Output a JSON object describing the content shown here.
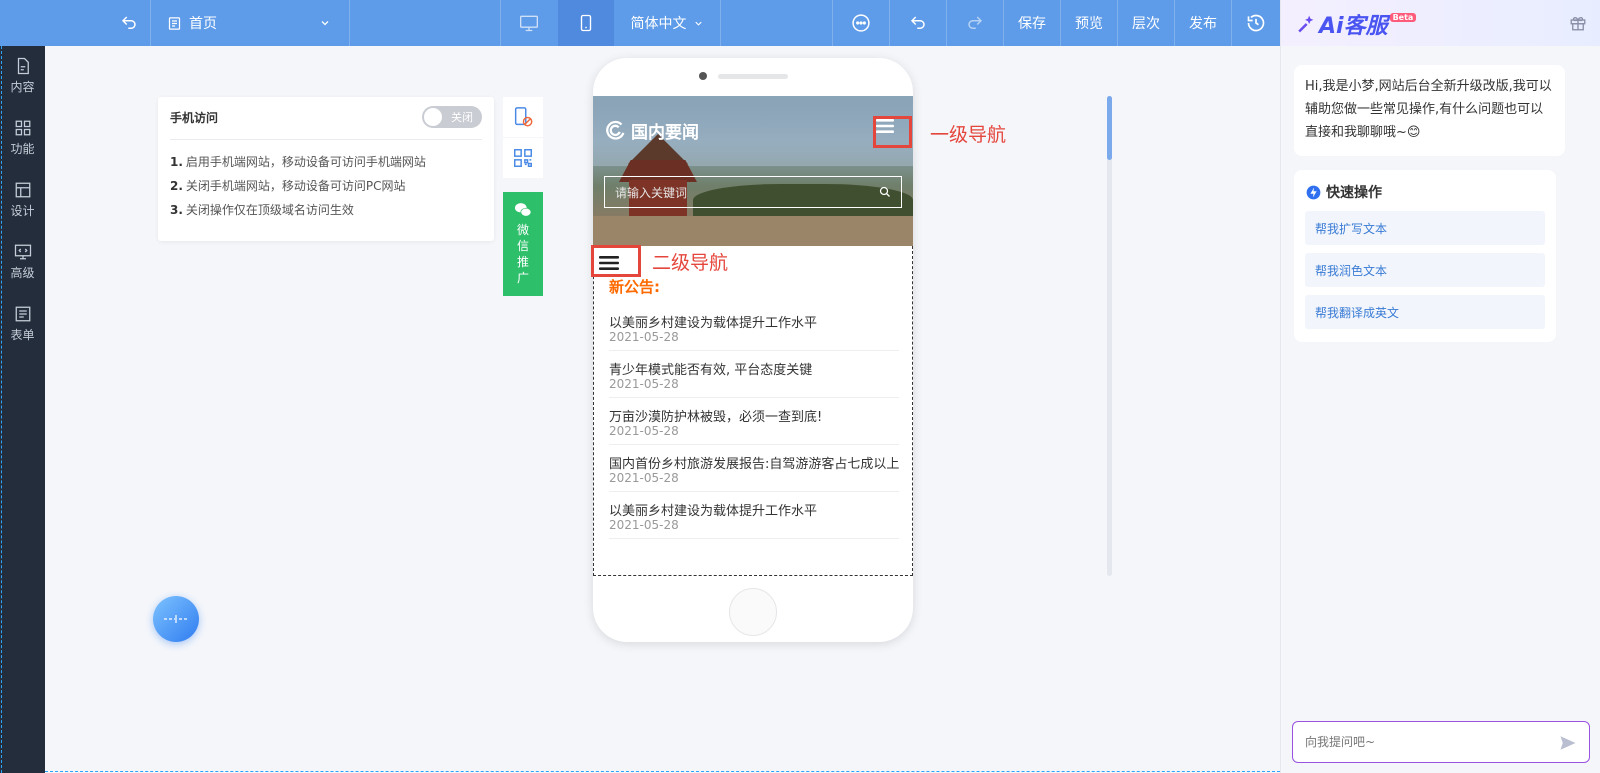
{
  "topbar": {
    "page_select": "首页",
    "language": "简体中文",
    "save": "保存",
    "preview": "预览",
    "layers": "层次",
    "publish": "发布"
  },
  "sidebar": {
    "items": [
      {
        "label": "内容",
        "icon": "file-icon"
      },
      {
        "label": "功能",
        "icon": "grid-icon"
      },
      {
        "label": "设计",
        "icon": "layout-icon"
      },
      {
        "label": "高级",
        "icon": "code-icon"
      },
      {
        "label": "表单",
        "icon": "form-icon"
      }
    ]
  },
  "mobile_access": {
    "title": "手机访问",
    "toggle_label": "关闭",
    "items": [
      {
        "num": "1.",
        "text": "启用手机端网站，移动设备可访问手机端网站"
      },
      {
        "num": "2.",
        "text": "关闭手机端网站，移动设备可访问PC网站"
      },
      {
        "num": "3.",
        "text": "关闭操作仅在顶级域名访问生效"
      }
    ]
  },
  "wechat_promo": "微信推广",
  "phone": {
    "site_name": "国内要闻",
    "search_placeholder": "请输入关键词",
    "notice_title": "新公告:",
    "news": [
      {
        "title": "以美丽乡村建设为载体提升工作水平",
        "date": "2021-05-28"
      },
      {
        "title": "青少年模式能否有效, 平台态度关键",
        "date": "2021-05-28"
      },
      {
        "title": "万亩沙漠防护林被毁，必须一查到底!",
        "date": "2021-05-28"
      },
      {
        "title": "国内首份乡村旅游发展报告:自驾游游客占七成以上",
        "date": "2021-05-28"
      },
      {
        "title": "以美丽乡村建设为载体提升工作水平",
        "date": "2021-05-28"
      }
    ]
  },
  "annotations": {
    "primary_nav": "一级导航",
    "secondary_nav": "二级导航"
  },
  "ai": {
    "title": "Ai客服",
    "badge": "Beta",
    "greeting": "Hi,我是小梦,网站后台全新升级改版,我可以辅助您做一些常见操作,有什么问题也可以直接和我聊聊哦~😊",
    "quick_title": "快速操作",
    "quick_items": [
      "帮我扩写文本",
      "帮我润色文本",
      "帮我翻译成英文"
    ],
    "input_placeholder": "向我提问吧~"
  },
  "colors": {
    "topbar": "#5e9be8",
    "sidebar": "#232d3c",
    "notice": "#ff6a00",
    "annotation": "#e5463c",
    "wechat": "#2dbf6a",
    "ai_accent": "#4a54f0"
  }
}
